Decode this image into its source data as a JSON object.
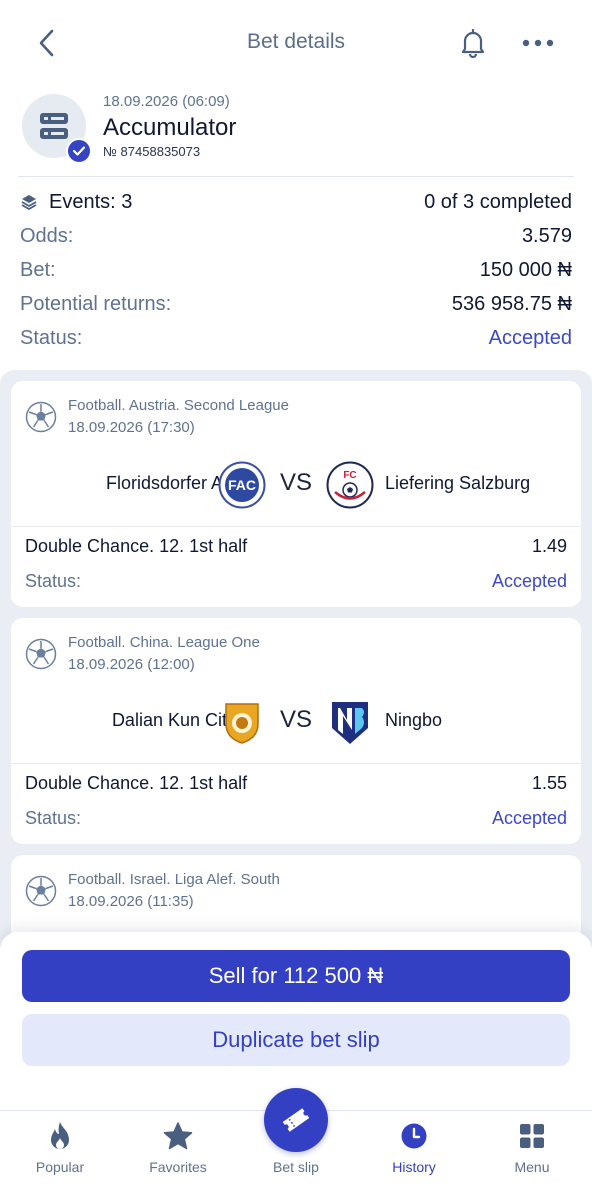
{
  "header": {
    "title": "Bet details"
  },
  "bet": {
    "date": "18.09.2026 (06:09)",
    "type": "Accumulator",
    "number": "№ 87458835073"
  },
  "summary": {
    "events_label": "Events: 3",
    "completed": "0 of 3 completed",
    "odds_label": "Odds:",
    "odds_value": "3.579",
    "bet_label": "Bet:",
    "bet_value": "150 000 ₦",
    "returns_label": "Potential returns:",
    "returns_value": "536 958.75 ₦",
    "status_label": "Status:",
    "status_value": "Accepted"
  },
  "events": [
    {
      "league": "Football. Austria. Second League",
      "date": "18.09.2026 (17:30)",
      "team1": "Floridsdorfer AC",
      "team1_logo_text": "FAC",
      "vs": "VS",
      "team2": "Liefering Salzburg",
      "team2_logo_text": "FC",
      "market": "Double Chance. 12. 1st half",
      "odds": "1.49",
      "status_label": "Status:",
      "status_value": "Accepted"
    },
    {
      "league": "Football. China. League One",
      "date": "18.09.2026 (12:00)",
      "team1": "Dalian Kun City",
      "vs": "VS",
      "team2": "Ningbo",
      "market": "Double Chance. 12. 1st half",
      "odds": "1.55",
      "status_label": "Status:",
      "status_value": "Accepted"
    },
    {
      "league": "Football. Israel. Liga Alef. South",
      "date": "18.09.2026 (11:35)"
    }
  ],
  "actions": {
    "sell": "Sell for 112 500 ₦",
    "duplicate": "Duplicate bet slip"
  },
  "tabs": {
    "popular": "Popular",
    "favorites": "Favorites",
    "betslip": "Bet slip",
    "history": "History",
    "menu": "Menu"
  },
  "colors": {
    "accent": "#3340c4",
    "status": "#3b49c9",
    "muted": "#5f7291"
  },
  "icons": [
    "back-icon",
    "bell-icon",
    "more-icon",
    "accumulator-icon",
    "check-icon",
    "layers-icon",
    "football-icon",
    "flame-icon",
    "star-icon",
    "ticket-icon",
    "clock-icon",
    "grid-icon"
  ]
}
